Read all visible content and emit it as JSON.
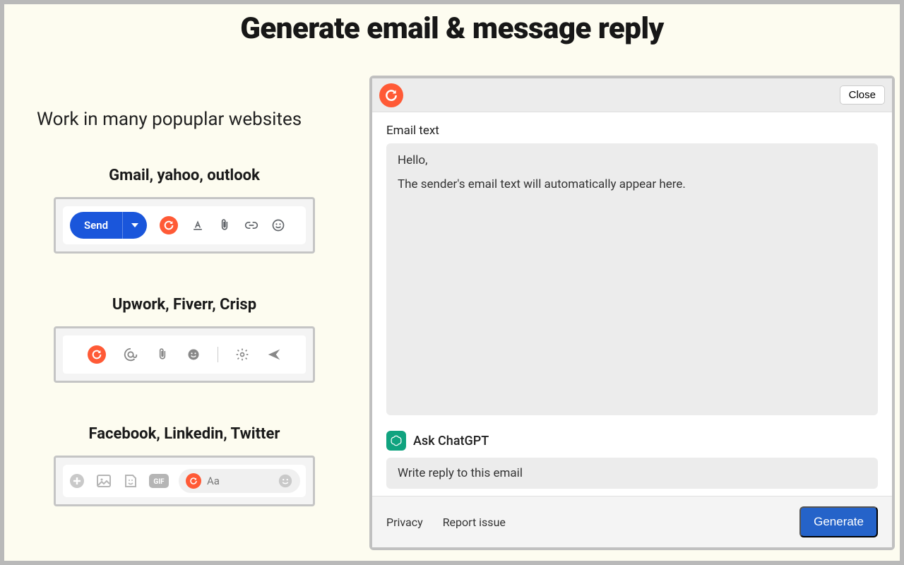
{
  "title": "Generate email & message reply",
  "subtitle": "Work in many popuplar websites",
  "blocks": {
    "b1": {
      "title": "Gmail, yahoo, outlook",
      "send": "Send"
    },
    "b2": {
      "title": "Upwork, Fiverr, Crisp"
    },
    "b3": {
      "title": "Facebook, Linkedin, Twitter",
      "placeholder": "Aa"
    }
  },
  "panel": {
    "close": "Close",
    "email_label": "Email text",
    "email_body_line1": "Hello,",
    "email_body_line2": "The sender's email text will automatically appear here.",
    "ask_label": "Ask ChatGPT",
    "prompt": "Write reply to this email",
    "privacy": "Privacy",
    "report": "Report issue",
    "generate": "Generate"
  }
}
